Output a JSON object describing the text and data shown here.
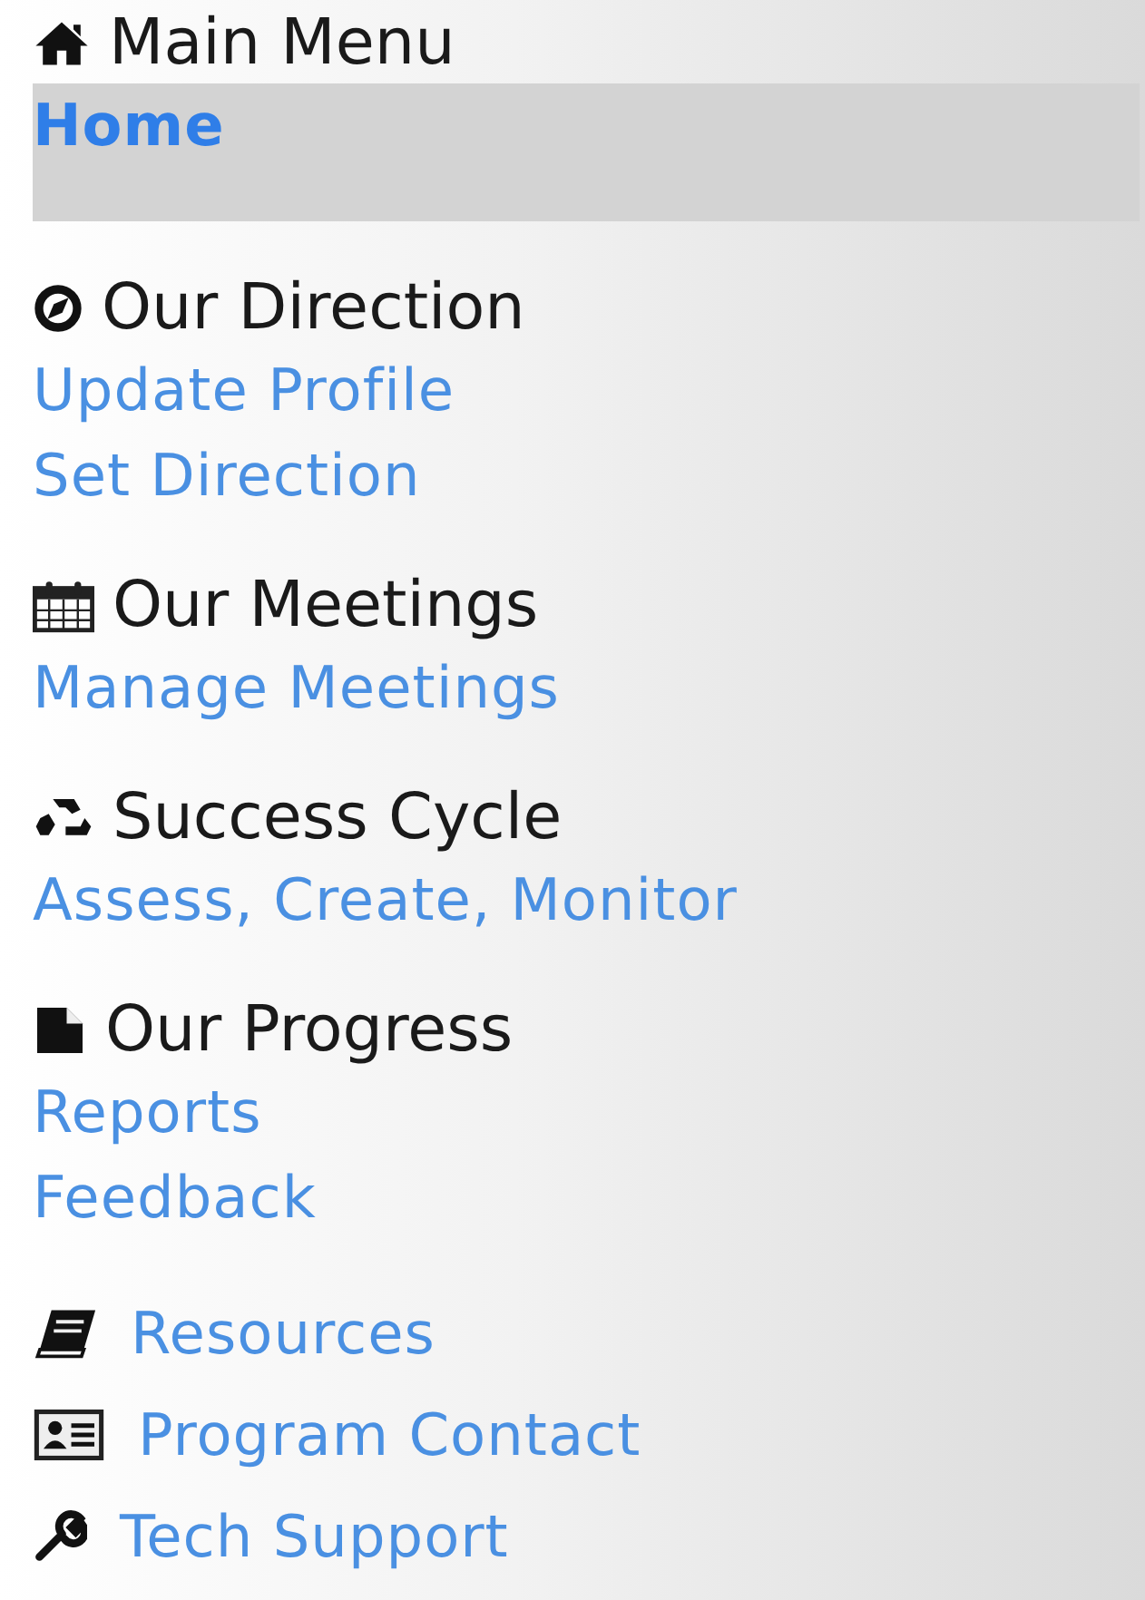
{
  "sections": [
    {
      "title": "Main Menu",
      "links": [
        {
          "label": "Home",
          "selected": true
        }
      ]
    },
    {
      "title": "Our Direction",
      "links": [
        {
          "label": "Update Profile",
          "selected": false
        },
        {
          "label": "Set Direction",
          "selected": false
        }
      ]
    },
    {
      "title": "Our Meetings",
      "links": [
        {
          "label": "Manage Meetings",
          "selected": false
        }
      ]
    },
    {
      "title": "Success Cycle",
      "links": [
        {
          "label": "Assess, Create, Monitor",
          "selected": false
        }
      ]
    },
    {
      "title": "Our Progress",
      "links": [
        {
          "label": "Reports",
          "selected": false
        },
        {
          "label": "Feedback",
          "selected": false
        }
      ]
    }
  ],
  "extra_links": [
    {
      "label": "Resources"
    },
    {
      "label": "Program Contact"
    },
    {
      "label": "Tech Support"
    }
  ]
}
